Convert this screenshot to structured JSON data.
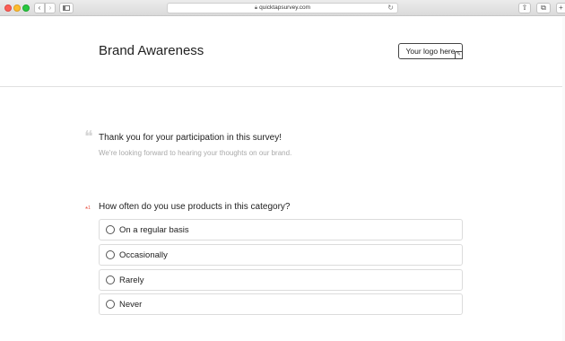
{
  "browser": {
    "url": "quicktapsurvey.com",
    "lock_icon": "lock-icon",
    "reload_icon": "reload-icon"
  },
  "header": {
    "title": "Brand Awareness",
    "logo_text": "Your logo here"
  },
  "intro": {
    "title": "Thank you for your participation in this survey!",
    "subtitle": "We're looking forward to hearing your thoughts on our brand."
  },
  "question": {
    "required_marker": "*",
    "number": "1",
    "text": "How often do you use products in this category?",
    "options": [
      {
        "label": "On a regular basis"
      },
      {
        "label": "Occasionally"
      },
      {
        "label": "Rarely"
      },
      {
        "label": "Never"
      }
    ]
  },
  "colors": {
    "required": "#e74c3c",
    "subtitle": "#aaaaaa"
  }
}
